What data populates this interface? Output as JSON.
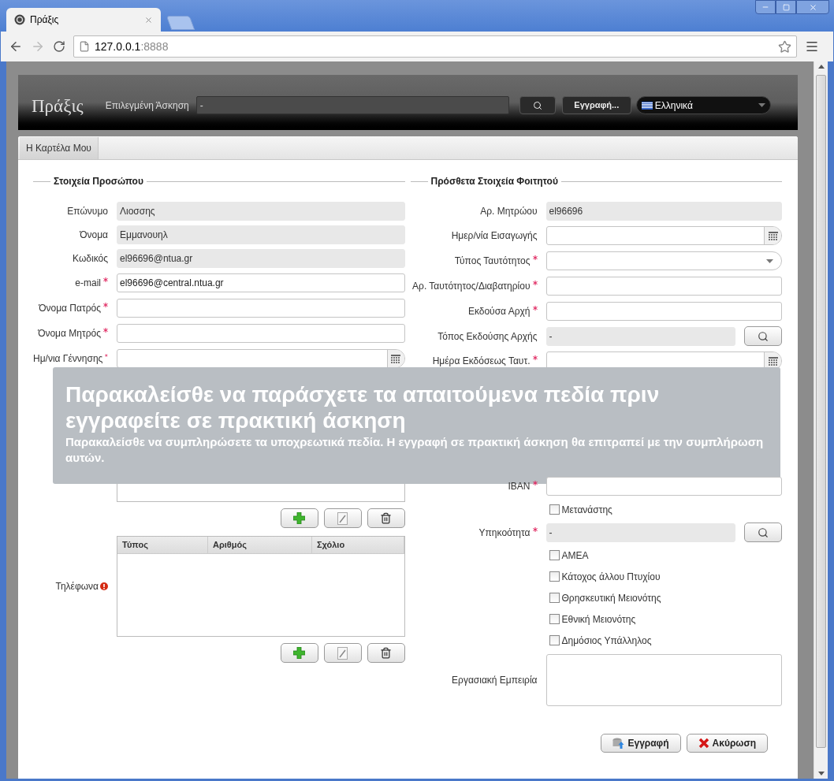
{
  "browser": {
    "tab": {
      "title": "Πράξις"
    },
    "address": {
      "host": "127.0.0.1",
      "port": ":8888"
    }
  },
  "header": {
    "logo": "Πράξις",
    "exercise_label": "Επιλεγμένη Άσκηση",
    "exercise_value": "-",
    "register_button": "Εγγραφή...",
    "language": "Ελληνικά"
  },
  "page_tabs": [
    {
      "label": "Η Καρτέλα Μου",
      "selected": true
    }
  ],
  "left": {
    "legend": "Στοιχεία Προσώπου",
    "fields": [
      {
        "kind": "readonly",
        "label": "Επώνυμο",
        "value": "Λιοσσης",
        "required": false
      },
      {
        "kind": "readonly",
        "label": "Όνομα",
        "value": "Εμμανουηλ",
        "required": false
      },
      {
        "kind": "readonly",
        "label": "Κωδικός",
        "value": "el96696@ntua.gr",
        "required": false
      },
      {
        "kind": "input",
        "label": "e-mail",
        "value": "el96696@central.ntua.gr",
        "required": true
      },
      {
        "kind": "input",
        "label": "Όνομα Πατρός",
        "required": true
      },
      {
        "kind": "input",
        "label": "Όνομα Μητρός",
        "required": true
      },
      {
        "kind": "date",
        "label": "Ημ/νια Γέννησης",
        "required": true
      }
    ]
  },
  "right": {
    "legend": "Πρόσθετα Στοιχεία Φοιτητού",
    "fields": [
      {
        "kind": "readonly",
        "label": "Αρ. Μητρώου",
        "value": "el96696",
        "required": false
      },
      {
        "kind": "date",
        "label": "Ημερ/νία Εισαγωγής",
        "required": false
      },
      {
        "kind": "select",
        "label": "Τύπος Ταυτότητος",
        "required": true
      },
      {
        "kind": "input",
        "label": "Αρ. Ταυτότητος/Διαβατηρίου",
        "required": true
      },
      {
        "kind": "input",
        "label": "Εκδούσα Αρχή",
        "required": true
      },
      {
        "kind": "lookup",
        "label": "Τόπος Εκδούσης Αρχής",
        "value": "-",
        "required": false
      },
      {
        "kind": "date",
        "label": "Ημέρα Εκδόσεως Ταυτ.",
        "required": true
      }
    ]
  },
  "notice": {
    "title": "Παρακαλείσθε να παράσχετε τα απαιτούμενα πεδία πριν εγγραφείτε σε πρακτική άσκηση",
    "message": "Παρακαλείσθε να συμπληρώσετε τα υποχρεωτικά πεδία. Η εγγραφή σε πρακτική άσκηση θα επιτραπεί με την συμπλήρωση αυτών."
  },
  "left_lower": {
    "fields": [
      {
        "kind": "table_end"
      },
      {
        "kind": "table",
        "label": "Τηλέφωνα",
        "error": true,
        "columns": [
          "Τύπος",
          "Αριθμός",
          "Σχόλιο"
        ]
      }
    ]
  },
  "right_lower": {
    "fields": [
      {
        "kind": "input",
        "label": "IBAN",
        "required": true
      },
      {
        "kind": "checkbox",
        "label": "Μετανάστης",
        "checked": false
      },
      {
        "kind": "lookup",
        "label": "Υπηκοότητα",
        "value": "-",
        "required": true
      },
      {
        "kind": "checkbox",
        "label": "ΑΜΕΑ",
        "checked": false
      },
      {
        "kind": "checkbox",
        "label": "Κάτοχος άλλου Πτυχίου",
        "checked": false
      },
      {
        "kind": "checkbox",
        "label": "Θρησκευτική Μειονότης",
        "checked": false
      },
      {
        "kind": "checkbox",
        "label": "Εθνική Μειονότης",
        "checked": false
      },
      {
        "kind": "checkbox",
        "label": "Δημόσιος Υπάλληλος",
        "checked": false
      },
      {
        "kind": "textarea",
        "label": "Εργασιακή Εμπειρία"
      }
    ]
  },
  "actions": [
    {
      "kind": "save",
      "label": "Εγγραφή"
    },
    {
      "kind": "cancel",
      "label": "Ακύρωση"
    }
  ]
}
